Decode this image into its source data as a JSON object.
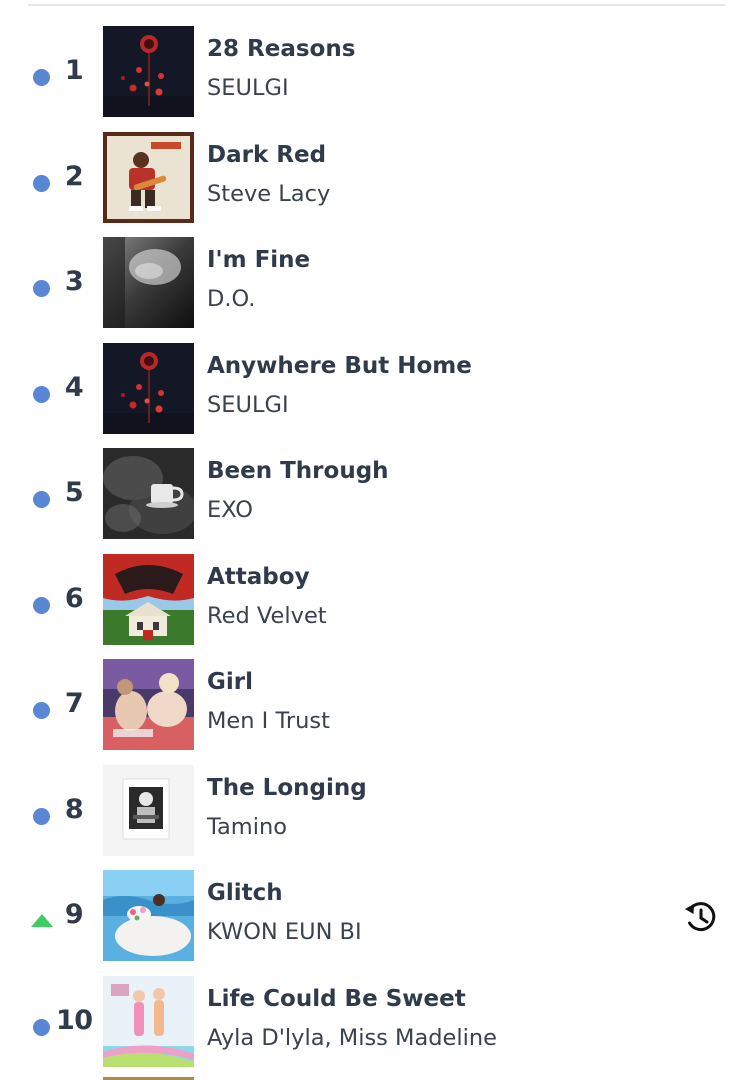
{
  "chart": {
    "entries": [
      {
        "rank": "1",
        "title": "28 Reasons",
        "artist": "SEULGI",
        "trend": "same",
        "artwork": "28-reasons-cover"
      },
      {
        "rank": "2",
        "title": "Dark Red",
        "artist": "Steve Lacy",
        "trend": "same",
        "artwork": "dark-red-cover"
      },
      {
        "rank": "3",
        "title": "I'm Fine",
        "artist": "D.O.",
        "trend": "same",
        "artwork": "im-fine-cover"
      },
      {
        "rank": "4",
        "title": "Anywhere But Home",
        "artist": "SEULGI",
        "trend": "same",
        "artwork": "28-reasons-cover"
      },
      {
        "rank": "5",
        "title": "Been Through",
        "artist": "EXO",
        "trend": "same",
        "artwork": "been-through-cover"
      },
      {
        "rank": "6",
        "title": "Attaboy",
        "artist": "Red Velvet",
        "trend": "same",
        "artwork": "attaboy-cover"
      },
      {
        "rank": "7",
        "title": "Girl",
        "artist": "Men I Trust",
        "trend": "same",
        "artwork": "girl-cover"
      },
      {
        "rank": "8",
        "title": "The Longing",
        "artist": "Tamino",
        "trend": "same",
        "artwork": "the-longing-cover"
      },
      {
        "rank": "9",
        "title": "Glitch",
        "artist": "KWON EUN BI",
        "trend": "up",
        "artwork": "glitch-cover",
        "history_icon": "history-icon"
      },
      {
        "rank": "10",
        "title": "Life Could Be Sweet",
        "artist": "Ayla D'lyla, Miss Madeline",
        "trend": "same",
        "artwork": "life-could-be-sweet-cover"
      }
    ]
  },
  "colors": {
    "text": "#2f3b4a",
    "same_indicator": "#5a86d6",
    "up_indicator": "#3fcc66",
    "divider": "#e4e6ea"
  }
}
